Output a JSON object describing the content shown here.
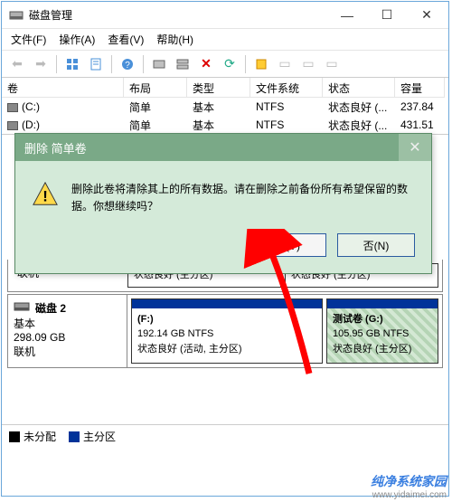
{
  "window": {
    "title": "磁盘管理",
    "controls": {
      "min": "—",
      "max": "☐",
      "close": "✕"
    }
  },
  "menu": {
    "file": "文件(F)",
    "action": "操作(A)",
    "view": "查看(V)",
    "help": "帮助(H)"
  },
  "toolbar_icons": [
    "back",
    "forward",
    "up",
    "props",
    "help",
    "list",
    "dm1",
    "delete",
    "refresh",
    "new",
    "dm2",
    "dm3",
    "dm4"
  ],
  "table": {
    "headers": {
      "vol": "卷",
      "layout": "布局",
      "type": "类型",
      "fs": "文件系统",
      "state": "状态",
      "cap": "容量"
    },
    "rows": [
      {
        "vol": "(C:)",
        "layout": "简单",
        "type": "基本",
        "fs": "NTFS",
        "state": "状态良好 (...",
        "cap": "237.84"
      },
      {
        "vol": "(D:)",
        "layout": "简单",
        "type": "基本",
        "fs": "NTFS",
        "state": "状态良好 (...",
        "cap": "431.51"
      }
    ]
  },
  "upper_disk": {
    "status": "联机",
    "parts": [
      {
        "state": "状态良好 (主分区)"
      },
      {
        "state": "状态良好 (主分区)"
      }
    ]
  },
  "disk2": {
    "label": "磁盘 2",
    "type": "基本",
    "size": "298.09 GB",
    "status": "联机",
    "parts": [
      {
        "name": "(F:)",
        "info": "192.14 GB NTFS",
        "state": "状态良好 (活动, 主分区)"
      },
      {
        "name": "测试卷   (G:)",
        "info": "105.95 GB NTFS",
        "state": "状态良好 (主分区)"
      }
    ]
  },
  "legend": {
    "unalloc": "未分配",
    "primary": "主分区"
  },
  "dialog": {
    "title": "删除 简单卷",
    "message": "删除此卷将清除其上的所有数据。请在删除之前备份所有希望保留的数据。你想继续吗？",
    "yes": "是(Y)",
    "no": "否(N)"
  },
  "watermark": {
    "brand": "纯净系统家园",
    "url": "www.yidaimei.com"
  }
}
